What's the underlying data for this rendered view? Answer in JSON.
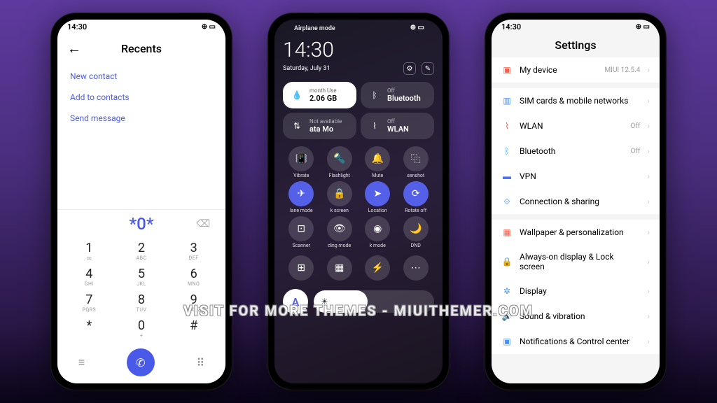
{
  "status": {
    "time": "14:30",
    "battery_glyph": "⊕ ▭"
  },
  "phone1": {
    "title": "Recents",
    "links": [
      "New contact",
      "Add to contacts",
      "Send message"
    ],
    "dialed": "*0*",
    "keys": [
      {
        "n": "1",
        "s": "∞"
      },
      {
        "n": "2",
        "s": "ABC"
      },
      {
        "n": "3",
        "s": "DEF"
      },
      {
        "n": "4",
        "s": "GHI"
      },
      {
        "n": "5",
        "s": "JKL"
      },
      {
        "n": "6",
        "s": "MNO"
      },
      {
        "n": "7",
        "s": "PQRS"
      },
      {
        "n": "8",
        "s": "TUV"
      },
      {
        "n": "9",
        "s": "WXYZ"
      },
      {
        "n": "*",
        "s": ""
      },
      {
        "n": "0",
        "s": "+"
      },
      {
        "n": "#",
        "s": ""
      }
    ]
  },
  "phone2": {
    "airplane": "Airplane mode",
    "time": "14:30",
    "date": "Saturday, July 31",
    "tiles": [
      {
        "icon": "💧",
        "top": "month    Use",
        "main": "2.06 GB",
        "white": true,
        "icon_name": "data-drop-icon"
      },
      {
        "icon": "ᛒ",
        "top": "Off",
        "main": "Bluetooth",
        "white": false,
        "icon_name": "bluetooth-icon"
      },
      {
        "icon": "⇅",
        "top": "Not available",
        "main": "ata   Mo",
        "white": false,
        "icon_name": "data-arrows-icon"
      },
      {
        "icon": "⌇",
        "top": "Off",
        "main": "WLAN",
        "white": false,
        "icon_name": "wifi-icon"
      }
    ],
    "toggles": [
      {
        "icon": "📳",
        "label": "Vibrate",
        "active": false,
        "icon_name": "vibrate-icon"
      },
      {
        "icon": "🔦",
        "label": "Flashlight",
        "active": false,
        "icon_name": "flashlight-icon"
      },
      {
        "icon": "🔔",
        "label": "Mute",
        "active": false,
        "icon_name": "bell-icon"
      },
      {
        "icon": "⿻",
        "label": "senshot",
        "active": false,
        "icon_name": "screenshot-icon"
      },
      {
        "icon": "✈",
        "label": "lane mode",
        "active": true,
        "icon_name": "airplane-icon"
      },
      {
        "icon": "🔒",
        "label": "k screen",
        "active": false,
        "icon_name": "lock-icon"
      },
      {
        "icon": "➤",
        "label": "Location",
        "active": true,
        "icon_name": "location-icon"
      },
      {
        "icon": "⟳",
        "label": "Rotate off",
        "active": true,
        "icon_name": "rotate-icon"
      },
      {
        "icon": "⊡",
        "label": "Scanner",
        "active": false,
        "icon_name": "scanner-icon"
      },
      {
        "icon": "👁",
        "label": "ding mode",
        "active": false,
        "icon_name": "eye-icon"
      },
      {
        "icon": "◉",
        "label": "k mode",
        "active": false,
        "icon_name": "dark-mode-icon"
      },
      {
        "icon": "🌙",
        "label": "DND",
        "active": false,
        "icon_name": "moon-icon"
      }
    ],
    "bottom_row3": [
      {
        "icon": "⊞",
        "label": ""
      },
      {
        "icon": "▦",
        "label": ""
      },
      {
        "icon": "⚡",
        "label": ""
      },
      {
        "icon": "⋯",
        "label": ""
      }
    ],
    "auto_label": "A"
  },
  "phone3": {
    "title": "Settings",
    "groups": [
      [
        {
          "icon": "▣",
          "color": "#ff5a4a",
          "label": "My device",
          "value": "MIUI 12.5.4",
          "icon_name": "device-icon"
        }
      ],
      [
        {
          "icon": "▥",
          "color": "#4a90ff",
          "label": "SIM cards & mobile networks",
          "value": "",
          "icon_name": "sim-icon"
        },
        {
          "icon": "⌇",
          "color": "#ff5a4a",
          "label": "WLAN",
          "value": "Off",
          "icon_name": "wifi-icon"
        },
        {
          "icon": "ᛒ",
          "color": "#4aa8ff",
          "label": "Bluetooth",
          "value": "Off",
          "icon_name": "bluetooth-icon"
        },
        {
          "icon": "▬",
          "color": "#4a72ff",
          "label": "VPN",
          "value": "",
          "icon_name": "vpn-icon"
        },
        {
          "icon": "⟐",
          "color": "#4a90ff",
          "label": "Connection & sharing",
          "value": "",
          "icon_name": "connection-icon"
        }
      ],
      [
        {
          "icon": "▦",
          "color": "#ff5a4a",
          "label": "Wallpaper & personalization",
          "value": "",
          "icon_name": "wallpaper-icon"
        },
        {
          "icon": "🔒",
          "color": "#ff5a4a",
          "label": "Always-on display & Lock screen",
          "value": "",
          "icon_name": "lock-icon"
        },
        {
          "icon": "✲",
          "color": "#4a90ff",
          "label": "Display",
          "value": "",
          "icon_name": "display-icon"
        },
        {
          "icon": "🔊",
          "color": "#ff8a4a",
          "label": "Sound & vibration",
          "value": "",
          "icon_name": "sound-icon"
        },
        {
          "icon": "▣",
          "color": "#4a90ff",
          "label": "Notifications & Control center",
          "value": "",
          "icon_name": "notifications-icon"
        }
      ]
    ]
  },
  "watermark": "VISIT FOR MORE THEMES - MIUITHEMER.COM"
}
